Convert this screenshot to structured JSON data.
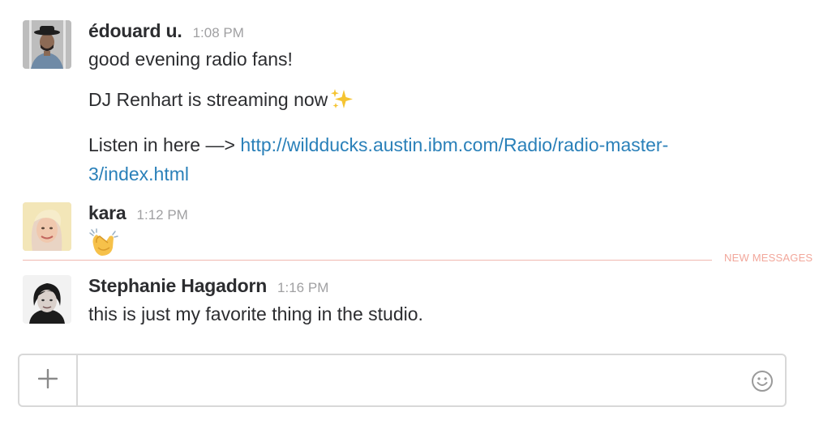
{
  "messages": [
    {
      "sender": "édouard u.",
      "time": "1:08 PM",
      "lines": [
        "good evening radio fans!",
        "DJ Renhart is streaming now"
      ],
      "link_prefix": "Listen in here —> ",
      "link_url_line1": "http://wildducks.austin.ibm.com/Radio/radio-master-",
      "link_url_line2": "3/index.html",
      "emoji": "sparkles-icon"
    },
    {
      "sender": "kara",
      "time": "1:12 PM",
      "emoji": "clapping-hands-icon"
    },
    {
      "sender": "Stephanie Hagadorn",
      "time": "1:16 PM",
      "text": "this is just my favorite thing in the studio."
    }
  ],
  "divider": {
    "label": "NEW MESSAGES",
    "color": "#f2a79b"
  },
  "composer": {
    "placeholder": "",
    "value": "",
    "plus_icon": "plus-icon",
    "emoji_icon": "smiley-icon"
  },
  "colors": {
    "link": "#2a80b9",
    "timestamp": "#a0a0a2",
    "text": "#2c2d30"
  }
}
